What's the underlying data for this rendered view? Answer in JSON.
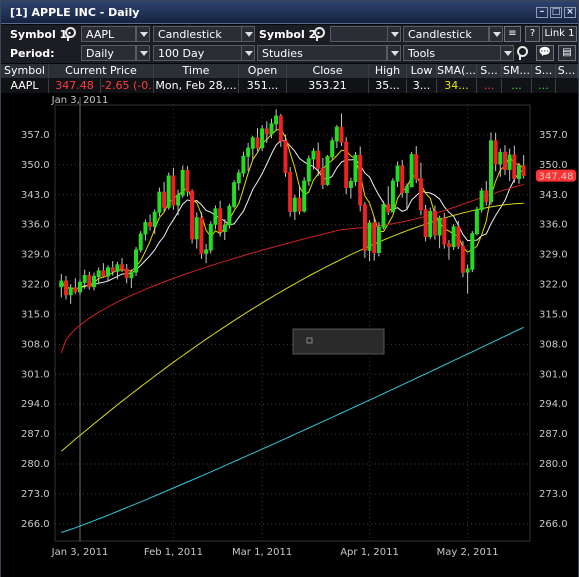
{
  "window": {
    "title": "[1] APPLE INC - Daily"
  },
  "toolbar": {
    "symbol1_label": "Symbol 1:",
    "symbol1_value": "AAPL",
    "chart_type1": "Candlestick",
    "symbol2_label": "Symbol 2:",
    "symbol2_value": "",
    "chart_type2": "Candlestick",
    "help_label": "?",
    "link_label": "Link 1",
    "period_label": "Period:",
    "period_value": "Daily",
    "range_value": "100 Day",
    "studies_value": "Studies",
    "tools_value": "Tools"
  },
  "quote": {
    "headers": [
      "Symbol",
      "Current Price",
      "Time",
      "Open",
      "Close",
      "High",
      "Low",
      "SMA(...",
      "S...",
      "SM...",
      "S...",
      "S..."
    ],
    "values": [
      "AAPL",
      "347.48",
      "-2.65 (-0...",
      "Mon, Feb 28,...",
      "351...",
      "353.21",
      "35...",
      "3...",
      "34...",
      "...",
      "...",
      "..."
    ],
    "colors": {
      "change": "#ff3b3b",
      "sma": "#e8e800",
      "dots_red": "#ff3b3b",
      "dots_green": "#33dd33"
    }
  },
  "chart_data": {
    "type": "candlestick",
    "symbol": "AAPL",
    "period": "Daily",
    "ylim": [
      262,
      364
    ],
    "yticks": [
      266.0,
      273.0,
      280.0,
      287.0,
      294.0,
      301.0,
      308.0,
      315.0,
      322.0,
      329.0,
      336.0,
      343.0,
      350.0,
      357.0
    ],
    "xticks": [
      "Jan 3, 2011",
      "Feb 1, 2011",
      "Mar 1, 2011",
      "Apr 1, 2011",
      "May 2, 2011"
    ],
    "top_date_label": "Jan 3, 2011",
    "last_price_label": "347.48",
    "colors": {
      "up": "#22dd22",
      "down": "#ee2222",
      "grid": "#3a3a3a",
      "crosshair": "#707070",
      "last_price": "#ff3333"
    },
    "candles": [
      [
        321.5,
        324.5,
        319.0,
        322.8
      ],
      [
        322.8,
        324.0,
        318.5,
        319.6
      ],
      [
        319.6,
        322.0,
        317.5,
        321.2
      ],
      [
        321.2,
        323.5,
        319.8,
        320.3
      ],
      [
        320.3,
        323.2,
        319.5,
        322.5
      ],
      [
        322.5,
        325.5,
        321.0,
        324.1
      ],
      [
        324.1,
        325.0,
        320.8,
        321.5
      ],
      [
        321.5,
        324.8,
        320.6,
        323.9
      ],
      [
        323.9,
        326.0,
        322.4,
        325.2
      ],
      [
        325.2,
        327.0,
        323.6,
        324.0
      ],
      [
        324.0,
        326.5,
        322.8,
        325.9
      ],
      [
        325.9,
        327.5,
        324.1,
        325.1
      ],
      [
        325.1,
        327.3,
        323.2,
        326.6
      ],
      [
        326.6,
        328.2,
        324.9,
        325.6
      ],
      [
        325.6,
        326.8,
        322.3,
        323.6
      ],
      [
        323.6,
        325.5,
        321.2,
        324.9
      ],
      [
        324.9,
        330.8,
        324.0,
        330.1
      ],
      [
        330.1,
        334.5,
        329.5,
        333.8
      ],
      [
        333.8,
        337.2,
        332.3,
        336.5
      ],
      [
        336.5,
        338.4,
        334.6,
        335.6
      ],
      [
        335.6,
        339.6,
        333.8,
        338.9
      ],
      [
        338.9,
        344.7,
        338.0,
        343.6
      ],
      [
        343.6,
        346.0,
        339.1,
        340.1
      ],
      [
        340.1,
        348.2,
        339.5,
        347.4
      ],
      [
        347.4,
        349.3,
        339.5,
        340.6
      ],
      [
        340.6,
        344.2,
        338.2,
        342.9
      ],
      [
        342.9,
        349.8,
        342.3,
        348.7
      ],
      [
        348.7,
        349.7,
        342.6,
        343.8
      ],
      [
        343.8,
        344.3,
        331.6,
        332.7
      ],
      [
        332.7,
        338.9,
        330.4,
        337.6
      ],
      [
        337.6,
        338.9,
        328.0,
        329.3
      ],
      [
        329.3,
        331.5,
        327.0,
        330.1
      ],
      [
        330.1,
        336.8,
        329.3,
        336.1
      ],
      [
        336.1,
        340.5,
        334.9,
        339.7
      ],
      [
        339.7,
        341.6,
        333.2,
        334.4
      ],
      [
        334.4,
        337.3,
        332.4,
        335.9
      ],
      [
        335.9,
        340.9,
        335.1,
        340.3
      ],
      [
        340.3,
        346.4,
        339.8,
        345.8
      ],
      [
        345.8,
        348.9,
        344.0,
        348.1
      ],
      [
        348.1,
        353.1,
        347.2,
        352.0
      ],
      [
        352.0,
        355.1,
        348.6,
        353.9
      ],
      [
        353.9,
        356.8,
        351.2,
        356.3
      ],
      [
        356.3,
        358.6,
        353.2,
        354.0
      ],
      [
        354.0,
        359.3,
        353.2,
        358.4
      ],
      [
        358.4,
        360.2,
        355.1,
        357.2
      ],
      [
        357.2,
        360.8,
        356.2,
        359.6
      ],
      [
        359.6,
        363.0,
        358.0,
        361.4
      ],
      [
        361.4,
        361.9,
        354.2,
        355.6
      ],
      [
        355.6,
        357.1,
        347.2,
        348.2
      ],
      [
        348.2,
        349.5,
        337.9,
        339.1
      ],
      [
        339.1,
        343.0,
        337.1,
        342.2
      ],
      [
        342.2,
        345.2,
        338.4,
        339.2
      ],
      [
        339.2,
        347.1,
        338.8,
        346.2
      ],
      [
        346.2,
        352.2,
        345.1,
        351.4
      ],
      [
        351.4,
        353.9,
        348.9,
        353.2
      ],
      [
        353.2,
        355.2,
        347.4,
        349.2
      ],
      [
        349.2,
        351.6,
        344.3,
        345.4
      ],
      [
        345.4,
        352.3,
        345.1,
        351.9
      ],
      [
        351.9,
        356.4,
        351.2,
        355.6
      ],
      [
        355.6,
        359.3,
        353.9,
        358.8
      ],
      [
        358.8,
        362.0,
        354.4,
        355.3
      ],
      [
        355.3,
        356.5,
        343.1,
        344.7
      ],
      [
        344.7,
        347.0,
        342.1,
        346.1
      ],
      [
        346.1,
        353.0,
        345.1,
        352.2
      ],
      [
        352.2,
        354.3,
        339.1,
        340.6
      ],
      [
        340.6,
        341.3,
        328.2,
        330.0
      ],
      [
        330.0,
        337.1,
        327.5,
        336.4
      ],
      [
        336.4,
        337.7,
        327.6,
        329.5
      ],
      [
        329.5,
        336.6,
        328.6,
        335.4
      ],
      [
        335.4,
        341.5,
        334.9,
        340.7
      ],
      [
        340.7,
        345.0,
        338.2,
        339.0
      ],
      [
        339.0,
        346.9,
        338.9,
        346.2
      ],
      [
        346.2,
        350.8,
        344.8,
        349.7
      ],
      [
        349.7,
        351.1,
        342.3,
        343.5
      ],
      [
        343.5,
        345.7,
        339.5,
        344.9
      ],
      [
        344.9,
        353.0,
        344.8,
        352.4
      ],
      [
        352.4,
        354.4,
        345.7,
        346.7
      ],
      [
        346.7,
        350.5,
        338.2,
        339.5
      ],
      [
        339.5,
        340.6,
        332.1,
        333.2
      ],
      [
        333.2,
        340.0,
        332.6,
        339.1
      ],
      [
        339.1,
        340.5,
        332.5,
        333.6
      ],
      [
        333.6,
        338.1,
        330.5,
        337.5
      ],
      [
        337.5,
        338.8,
        330.4,
        331.5
      ],
      [
        331.5,
        332.4,
        327.8,
        330.9
      ],
      [
        330.9,
        336.1,
        330.1,
        335.5
      ],
      [
        335.5,
        336.9,
        330.3,
        331.0
      ],
      [
        331.0,
        332.2,
        323.7,
        324.9
      ],
      [
        324.9,
        326.7,
        319.9,
        325.6
      ],
      [
        325.6,
        334.5,
        324.9,
        333.9
      ],
      [
        333.9,
        340.2,
        333.5,
        339.5
      ],
      [
        339.5,
        344.6,
        338.8,
        343.9
      ],
      [
        343.9,
        346.2,
        340.5,
        341.4
      ],
      [
        341.4,
        357.6,
        340.7,
        355.6
      ],
      [
        355.6,
        357.5,
        348.5,
        350.2
      ],
      [
        350.2,
        353.8,
        347.2,
        352.9
      ],
      [
        352.9,
        354.6,
        347.6,
        348.9
      ],
      [
        348.9,
        353.8,
        346.2,
        352.3
      ],
      [
        352.3,
        354.5,
        345.8,
        346.8
      ],
      [
        346.8,
        350.4,
        345.6,
        349.8
      ],
      [
        349.8,
        352.3,
        346.8,
        347.5
      ]
    ],
    "sma_short": [],
    "sma_medium": [],
    "sma_long_yellow": [],
    "sma_long_cyan": []
  }
}
